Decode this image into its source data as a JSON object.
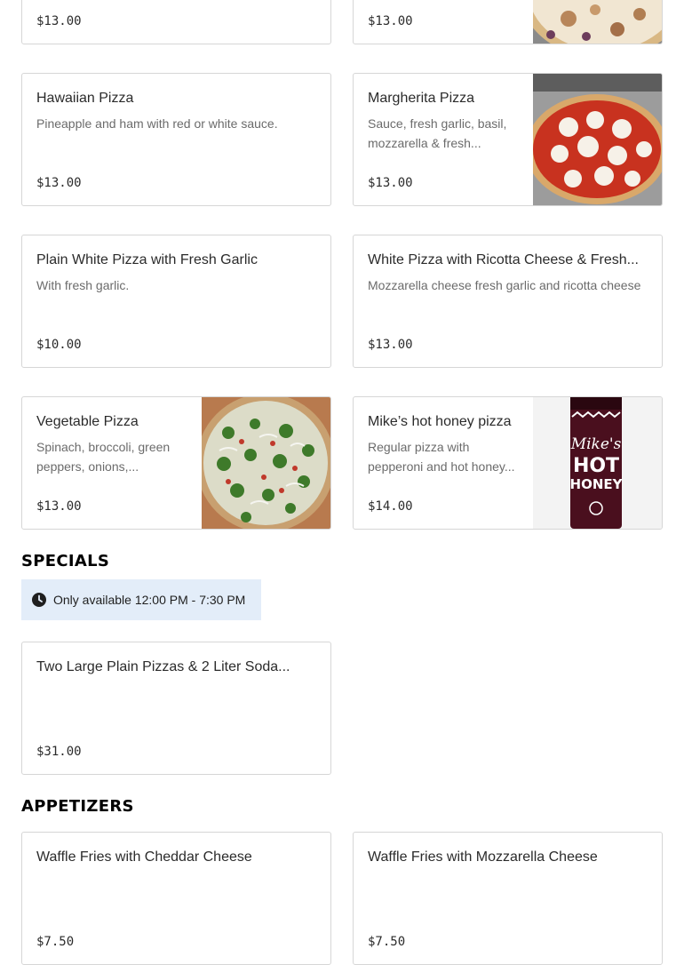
{
  "menu_items": {
    "partial_left": {
      "price": "$13.00"
    },
    "partial_right": {
      "price": "$13.00"
    },
    "hawaiian": {
      "title": "Hawaiian Pizza",
      "desc": "Pineapple and ham with red or white sauce.",
      "price": "$13.00"
    },
    "margherita": {
      "title": "Margherita Pizza",
      "desc": "Sauce, fresh garlic, basil, mozzarella & fresh...",
      "price": "$13.00"
    },
    "plain_white": {
      "title": "Plain White Pizza with Fresh Garlic",
      "desc": "With fresh garlic.",
      "price": "$10.00"
    },
    "white_ricotta": {
      "title": "White Pizza with Ricotta Cheese & Fresh...",
      "desc": "Mozzarella cheese fresh garlic and ricotta cheese",
      "price": "$13.00"
    },
    "vegetable": {
      "title": "Vegetable Pizza",
      "desc": "Spinach, broccoli, green peppers, onions,...",
      "price": "$13.00"
    },
    "mikes_hot_honey": {
      "title": "Mike’s hot honey pizza",
      "desc": "Regular pizza with pepperoni and hot honey...",
      "price": "$14.00"
    }
  },
  "specials": {
    "heading": "SPECIALS",
    "availability": "Only available 12:00 PM - 7:30 PM",
    "items": {
      "two_large": {
        "title": "Two Large Plain Pizzas & 2 Liter Soda...",
        "price": "$31.00"
      }
    }
  },
  "appetizers": {
    "heading": "APPETIZERS",
    "items": {
      "fries_cheddar": {
        "title": "Waffle Fries with Cheddar Cheese",
        "price": "$7.50"
      },
      "fries_mozzarella": {
        "title": "Waffle Fries with Mozzarella Cheese",
        "price": "$7.50"
      }
    }
  },
  "product_label": {
    "line1": "Mike's",
    "line2": "HOT",
    "line3": "HONEY"
  },
  "colors": {
    "availability_bg": "#e3edf9",
    "card_border": "#d6d6d6",
    "description_text": "#6b6b6b"
  }
}
